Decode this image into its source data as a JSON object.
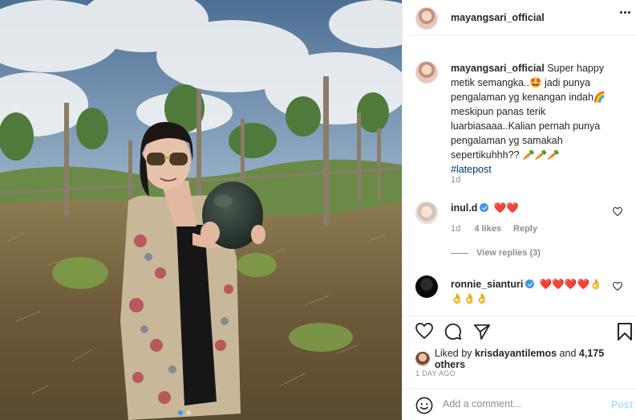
{
  "post": {
    "username": "mayangsari_official",
    "caption": "Super happy metik semangka..🤩 jadi punya pengalaman yg kenangan indah🌈 meskipun panas terik luarbiasaaa..Kalian pernah punya pengalaman yg samakah sepertikuhhh?? 🥕🥕🥕",
    "hashtag": "#latepost",
    "caption_age": "1d"
  },
  "comments": [
    {
      "username": "inul.d",
      "text": "❤️❤️",
      "age": "1d",
      "likes": "4 likes",
      "reply": "Reply",
      "view_replies": "View replies (3)"
    },
    {
      "username": "ronnie_sianturi",
      "text": "❤️❤️❤️❤️👌👌👌👌"
    }
  ],
  "likes": {
    "prefix": "Liked by",
    "user": "krisdayantilemos",
    "and": "and",
    "others": "4,175 others"
  },
  "date": "1 DAY AGO",
  "add_comment": {
    "placeholder": "Add a comment...",
    "post_label": "Post"
  },
  "colors": {
    "link_blue": "#00376b",
    "verified_blue": "#3897f0",
    "post_disabled": "#b2dffc",
    "heart_red": "#ed4956"
  },
  "carousel": {
    "count": 2,
    "active": 1
  }
}
